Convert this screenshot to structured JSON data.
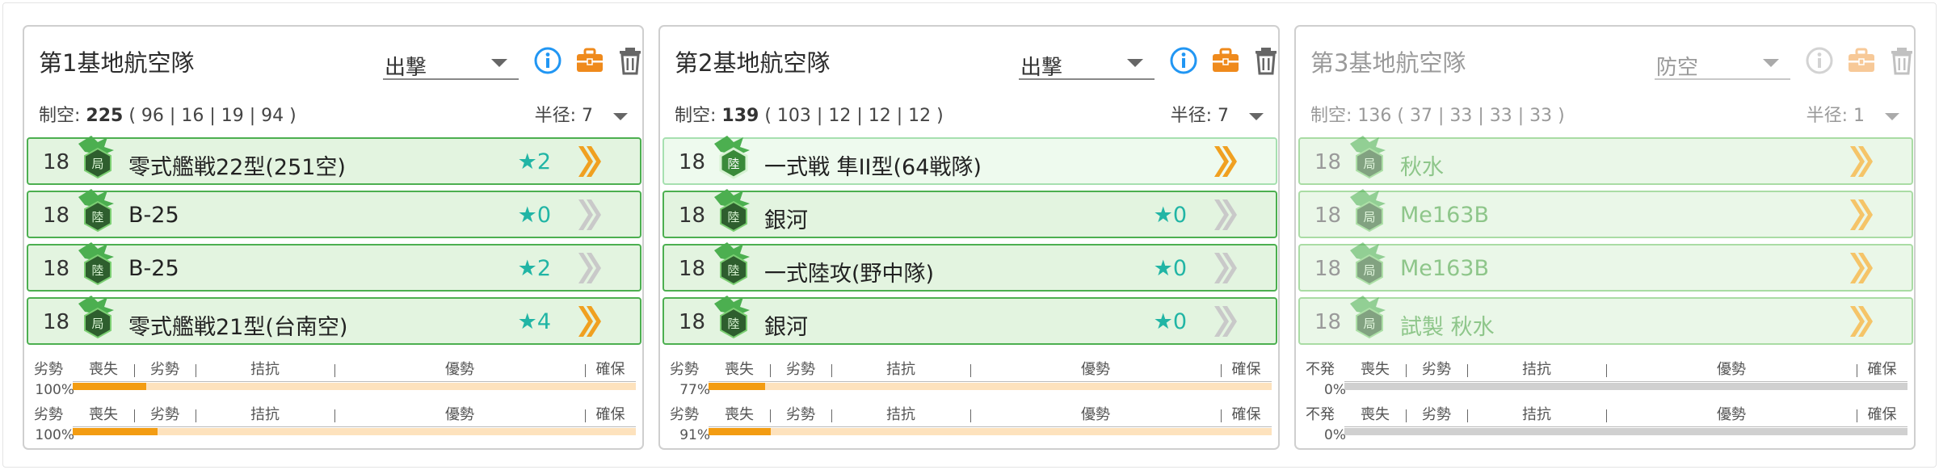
{
  "colors": {
    "accent_blue": "#2196f3",
    "case_orange": "#ef8a1c",
    "slot_border": "#4caf50",
    "slot_bg": "#e3f4e0",
    "star": "#21b5a5",
    "bar_fill": "#f39c12",
    "bar_track": "#fde2bd"
  },
  "air_state_labels": [
    "喪失",
    "劣勢",
    "拮抗",
    "優勢",
    "確保"
  ],
  "radius_label": "半径:",
  "air_power_label": "制空:",
  "squadrons": [
    {
      "title": "第1基地航空隊",
      "mode": "出撃",
      "disabled": false,
      "air_power": "225",
      "air_power_detail": "( 96 | 16 | 19 | 94 )",
      "radius": "7",
      "slots": [
        {
          "count": "18",
          "name": "零式艦戦22型(251空)",
          "stars": "★2",
          "proficiency": "max"
        },
        {
          "count": "18",
          "name": "B-25",
          "stars": "★0",
          "proficiency": "none"
        },
        {
          "count": "18",
          "name": "B-25",
          "stars": "★2",
          "proficiency": "none"
        },
        {
          "count": "18",
          "name": "零式艦戦21型(台南空)",
          "stars": "★4",
          "proficiency": "max"
        }
      ],
      "bars": [
        {
          "status": "劣勢",
          "percent": "100%",
          "fill": 0.13
        },
        {
          "status": "劣勢",
          "percent": "100%",
          "fill": 0.15
        }
      ]
    },
    {
      "title": "第2基地航空隊",
      "mode": "出撃",
      "disabled": false,
      "air_power": "139",
      "air_power_detail": "( 103 | 12 | 12 | 12 )",
      "radius": "7",
      "slots": [
        {
          "count": "18",
          "name": "一式戦 隼II型(64戦隊)",
          "stars": "",
          "proficiency": "max"
        },
        {
          "count": "18",
          "name": "銀河",
          "stars": "★0",
          "proficiency": "none"
        },
        {
          "count": "18",
          "name": "一式陸攻(野中隊)",
          "stars": "★0",
          "proficiency": "none"
        },
        {
          "count": "18",
          "name": "銀河",
          "stars": "★0",
          "proficiency": "none"
        }
      ],
      "bars": [
        {
          "status": "劣勢",
          "percent": "77%",
          "fill": 0.1
        },
        {
          "status": "劣勢",
          "percent": "91%",
          "fill": 0.11
        }
      ]
    },
    {
      "title": "第3基地航空隊",
      "mode": "防空",
      "disabled": true,
      "air_power": "136",
      "air_power_detail": "( 37 | 33 | 33 | 33 )",
      "radius": "1",
      "slots": [
        {
          "count": "18",
          "name": "秋水",
          "stars": "",
          "proficiency": "max"
        },
        {
          "count": "18",
          "name": "Me163B",
          "stars": "",
          "proficiency": "max"
        },
        {
          "count": "18",
          "name": "Me163B",
          "stars": "",
          "proficiency": "max"
        },
        {
          "count": "18",
          "name": "試製 秋水",
          "stars": "",
          "proficiency": "max"
        }
      ],
      "bars": [
        {
          "status": "不発",
          "percent": "0%",
          "fill": 0
        },
        {
          "status": "不発",
          "percent": "0%",
          "fill": 0
        }
      ]
    }
  ]
}
